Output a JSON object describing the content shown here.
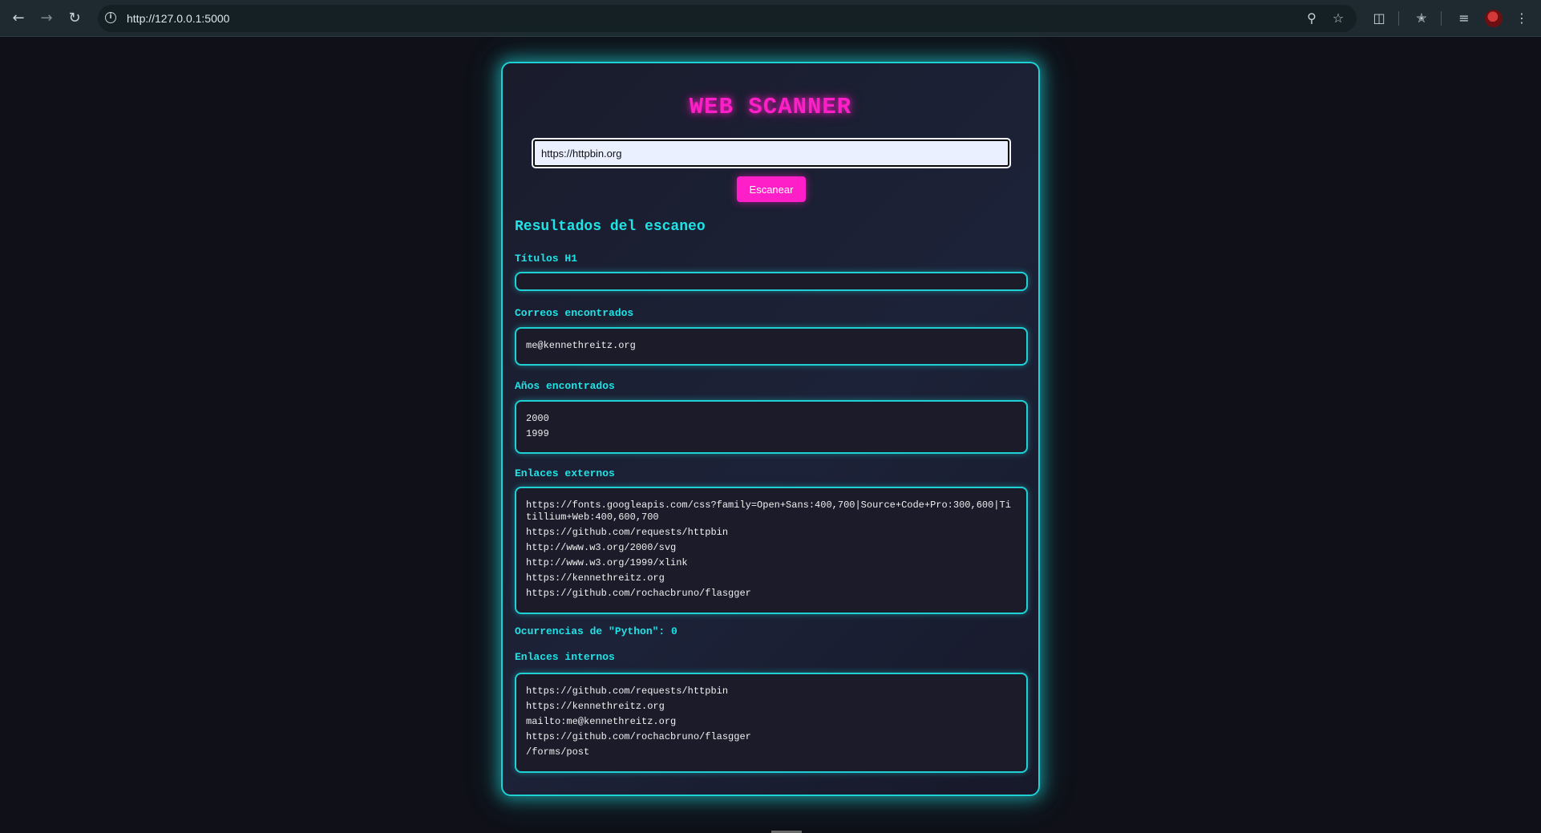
{
  "browser": {
    "url": "http://127.0.0.1:5000",
    "icons": {
      "back": "back-arrow-icon",
      "forward": "forward-arrow-icon",
      "reload": "reload-icon",
      "site_info": "info-icon",
      "zoom": "zoom-icon",
      "bookmark": "star-icon",
      "extensions": "puzzle-icon",
      "bookmarks_bar": "star-list-icon",
      "media": "media-control-icon",
      "menu": "kebab-menu-icon"
    }
  },
  "app": {
    "title": "WEB SCANNER",
    "url_input_value": "https://httpbin.org",
    "scan_button_label": "Escanear",
    "results_heading": "Resultados del escaneo",
    "sections": {
      "h1": {
        "label": "Títulos H1",
        "items": []
      },
      "emails": {
        "label": "Correos encontrados",
        "items": [
          "me@kennethreitz.org"
        ]
      },
      "years": {
        "label": "Años encontrados",
        "items": [
          "2000",
          "1999"
        ]
      },
      "external_links": {
        "label": "Enlaces externos",
        "items": [
          "https://fonts.googleapis.com/css?family=Open+Sans:400,700|Source+Code+Pro:300,600|Titillium+Web:400,600,700",
          "https://github.com/requests/httpbin",
          "http://www.w3.org/2000/svg",
          "http://www.w3.org/1999/xlink",
          "https://kennethreitz.org",
          "https://github.com/rochacbruno/flasgger"
        ]
      },
      "python_count": {
        "label": "Ocurrencias de \"Python\": 0"
      },
      "internal_links": {
        "label": "Enlaces internos",
        "items": [
          "https://github.com/requests/httpbin",
          "https://kennethreitz.org",
          "mailto:me@kennethreitz.org",
          "https://github.com/rochacbruno/flasgger",
          "/forms/post"
        ]
      }
    }
  },
  "colors": {
    "accent_pink": "#ff1fc8",
    "accent_cyan": "#1fd1d4",
    "background": "#0f1018"
  }
}
